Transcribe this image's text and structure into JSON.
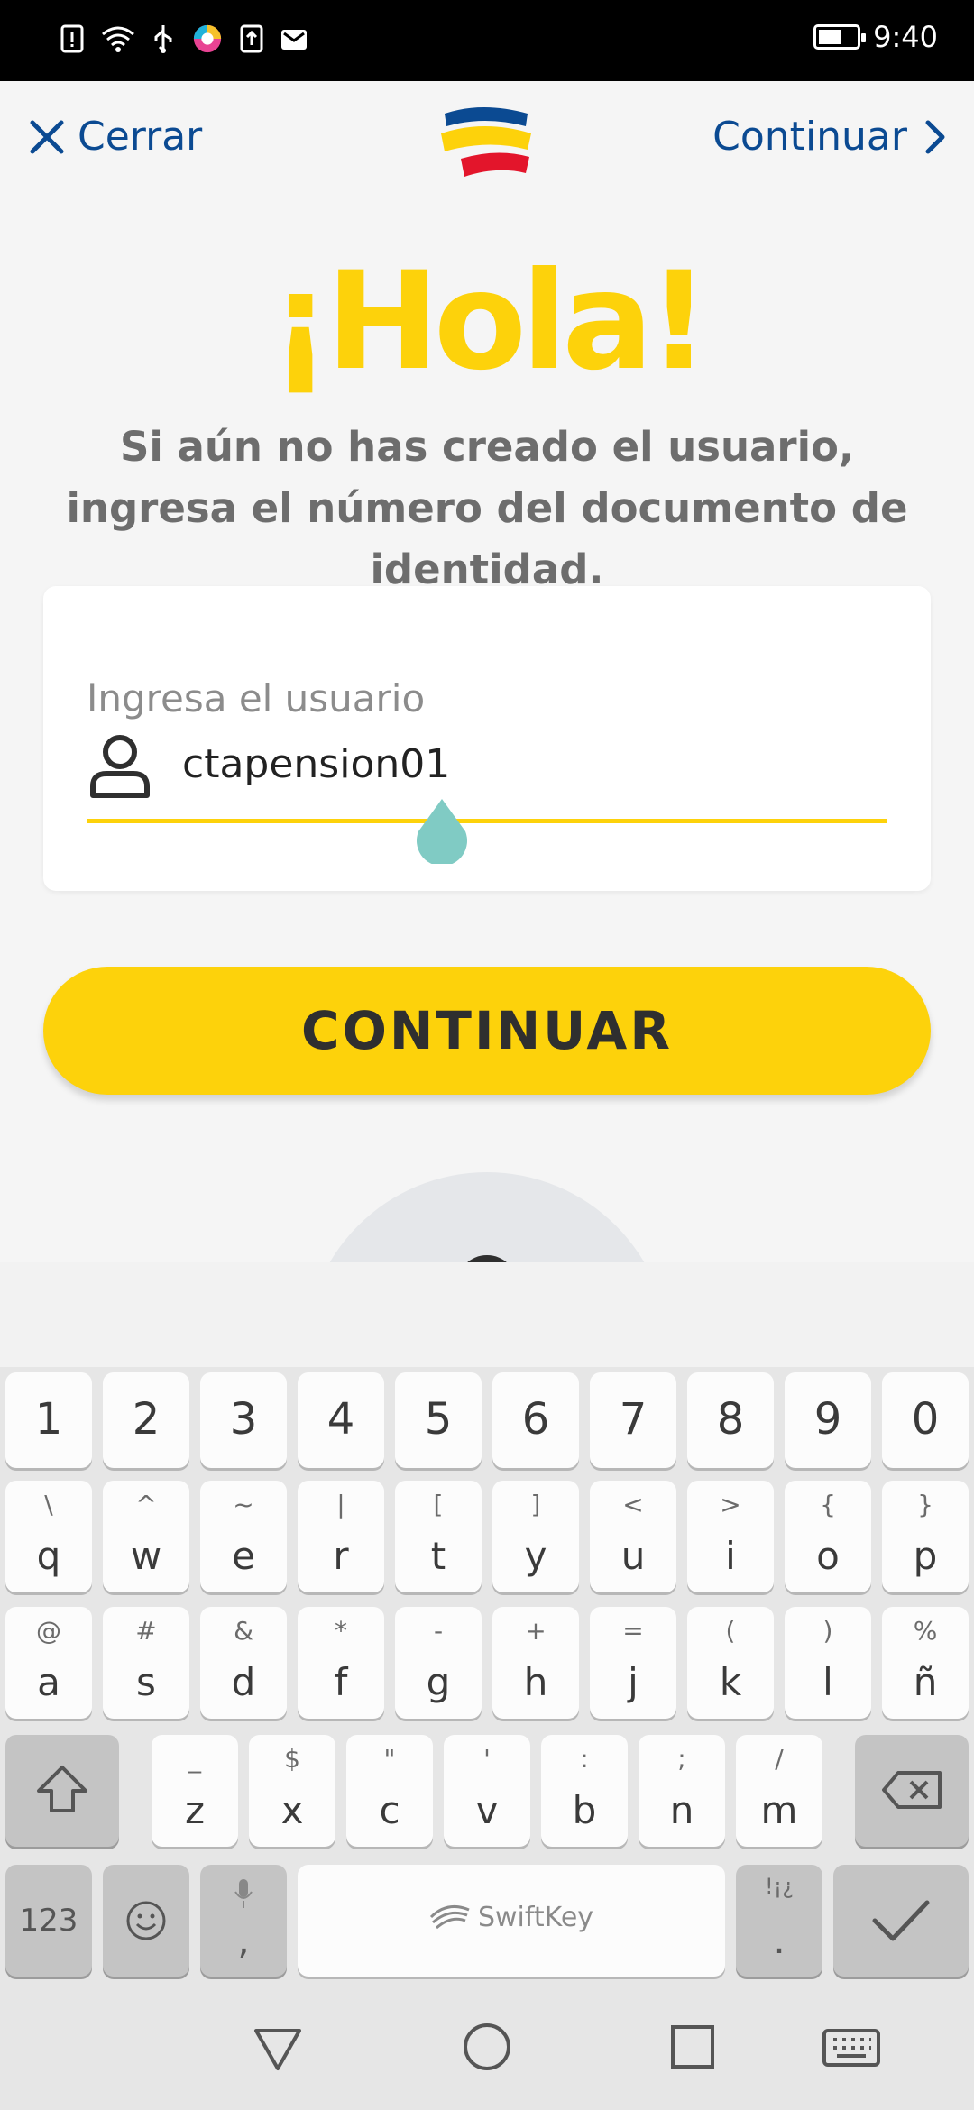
{
  "status_bar": {
    "time": "9:40",
    "icons": [
      "alert-icon",
      "wifi-icon",
      "usb-icon",
      "app-icon",
      "upload-icon",
      "mail-icon"
    ],
    "battery_icon": "battery-charging-icon"
  },
  "header": {
    "close_label": "Cerrar",
    "next_label": "Continuar",
    "logo": "bancolombia-logo"
  },
  "greeting": {
    "title": "¡Hola!",
    "subtitle": "Si aún no has creado el usuario, ingresa el número del documento de identidad."
  },
  "login_form": {
    "field_label": "Ingresa el usuario",
    "field_value": "ctapension01",
    "field_icon": "user-icon"
  },
  "continue_button": "CONTINUAR",
  "keyboard": {
    "number_row": [
      "1",
      "2",
      "3",
      "4",
      "5",
      "6",
      "7",
      "8",
      "9",
      "0"
    ],
    "row1": [
      {
        "alt": "\\",
        "main": "q"
      },
      {
        "alt": "^",
        "main": "w"
      },
      {
        "alt": "~",
        "main": "e"
      },
      {
        "alt": "|",
        "main": "r"
      },
      {
        "alt": "[",
        "main": "t"
      },
      {
        "alt": "]",
        "main": "y"
      },
      {
        "alt": "<",
        "main": "u"
      },
      {
        "alt": ">",
        "main": "i"
      },
      {
        "alt": "{",
        "main": "o"
      },
      {
        "alt": "}",
        "main": "p"
      }
    ],
    "row2": [
      {
        "alt": "@",
        "main": "a"
      },
      {
        "alt": "#",
        "main": "s"
      },
      {
        "alt": "&",
        "main": "d"
      },
      {
        "alt": "*",
        "main": "f"
      },
      {
        "alt": "-",
        "main": "g"
      },
      {
        "alt": "+",
        "main": "h"
      },
      {
        "alt": "=",
        "main": "j"
      },
      {
        "alt": "(",
        "main": "k"
      },
      {
        "alt": ")",
        "main": "l"
      },
      {
        "alt": "%",
        "main": "ñ"
      }
    ],
    "row3": [
      {
        "alt": "_",
        "main": "z"
      },
      {
        "alt": "$",
        "main": "x"
      },
      {
        "alt": "\"",
        "main": "c"
      },
      {
        "alt": "'",
        "main": "v"
      },
      {
        "alt": ":",
        "main": "b"
      },
      {
        "alt": ";",
        "main": "n"
      },
      {
        "alt": "/",
        "main": "m"
      }
    ],
    "numbers_key": "123",
    "comma_key": ",",
    "period_key": ".",
    "period_alt": "!¡¿",
    "space_brand": "SwiftKey"
  },
  "colors": {
    "brand_yellow": "#fdd20b",
    "brand_blue": "#0b4a92",
    "brand_red": "#e3152b"
  }
}
